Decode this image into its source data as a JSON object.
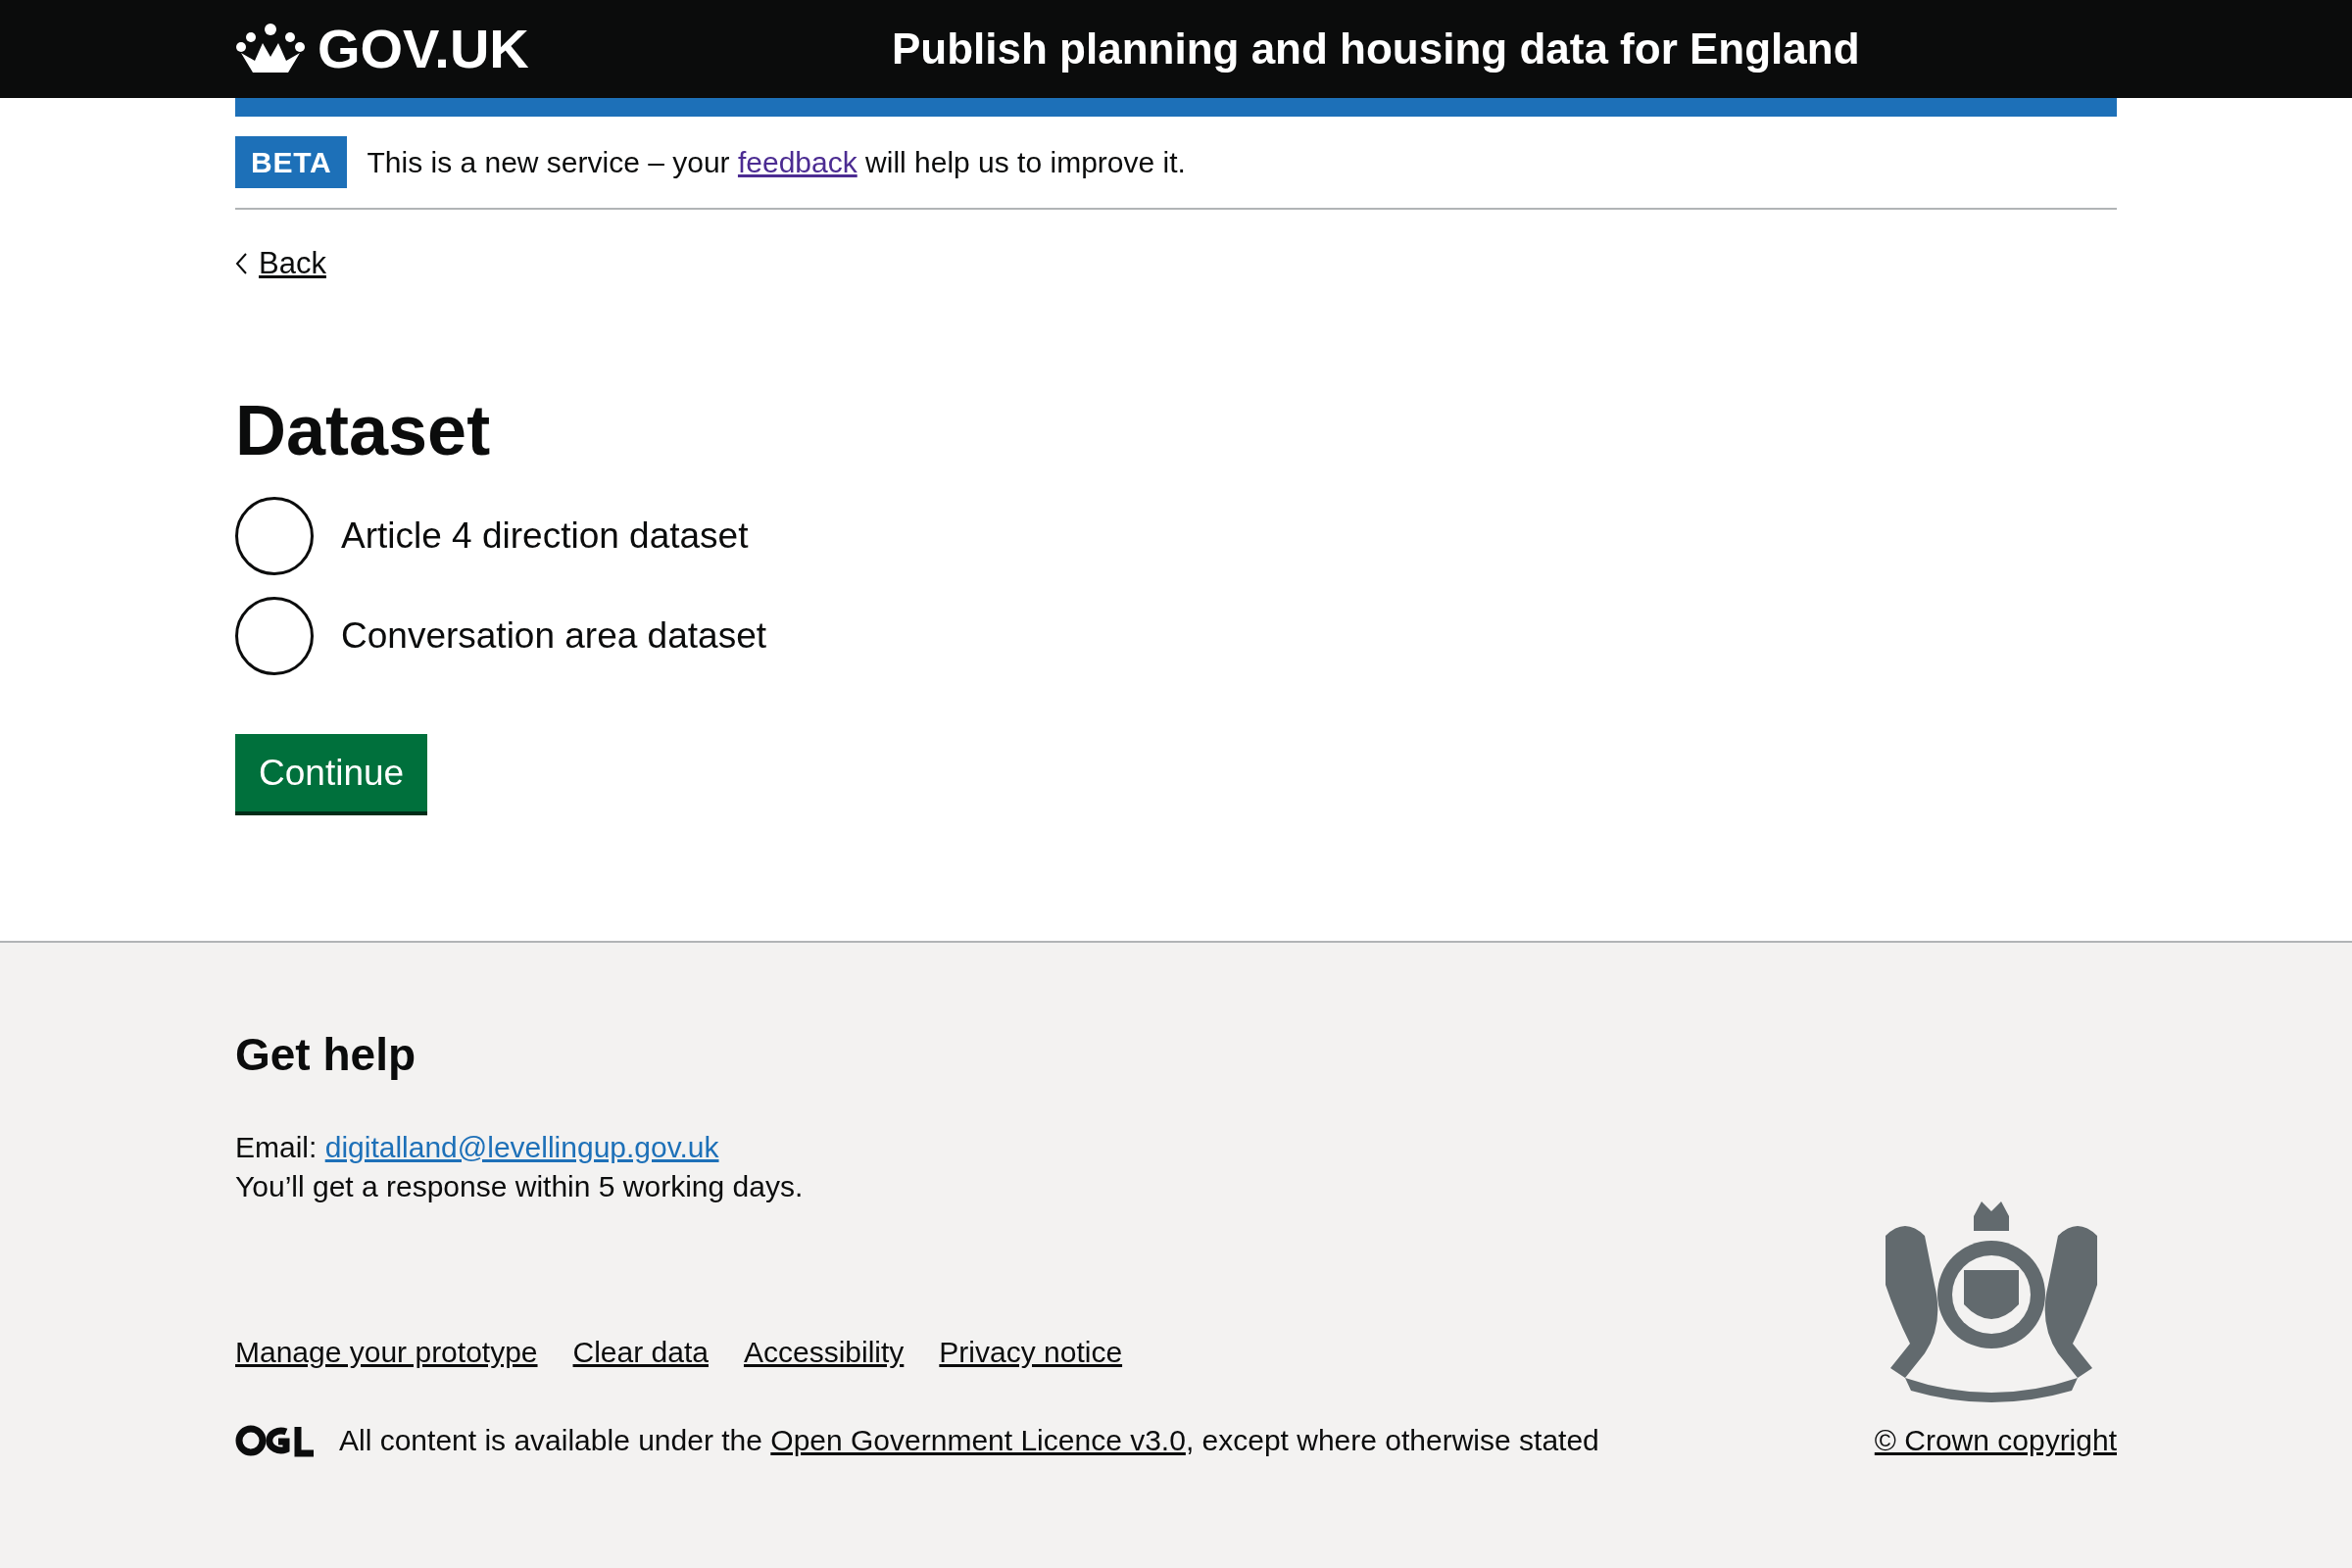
{
  "header": {
    "logo_text": "GOV.UK",
    "service_name": "Publish planning and housing data for England"
  },
  "phase_banner": {
    "tag": "BETA",
    "text_before": "This is a new service – your",
    "link": "feedback",
    "text_after": "will help us to improve it."
  },
  "back_link": "Back",
  "question": {
    "heading": "Dataset",
    "options": [
      {
        "label": "Article 4 direction dataset",
        "selected": false
      },
      {
        "label": "Conversation area dataset",
        "selected": false
      }
    ]
  },
  "continue_button": "Continue",
  "footer": {
    "help_heading": "Get help",
    "email_label": "Email:",
    "email": "digitalland@levellingup.gov.uk",
    "response_note": "You’ll get a response within 5 working days.",
    "links": [
      "Manage your prototype",
      "Clear data",
      "Accessibility",
      "Privacy notice"
    ],
    "licence_before": "All content is available under the",
    "licence_link": "Open Government Licence v3.0",
    "licence_after": ", except where otherwise stated",
    "copyright": "© Crown copyright"
  }
}
